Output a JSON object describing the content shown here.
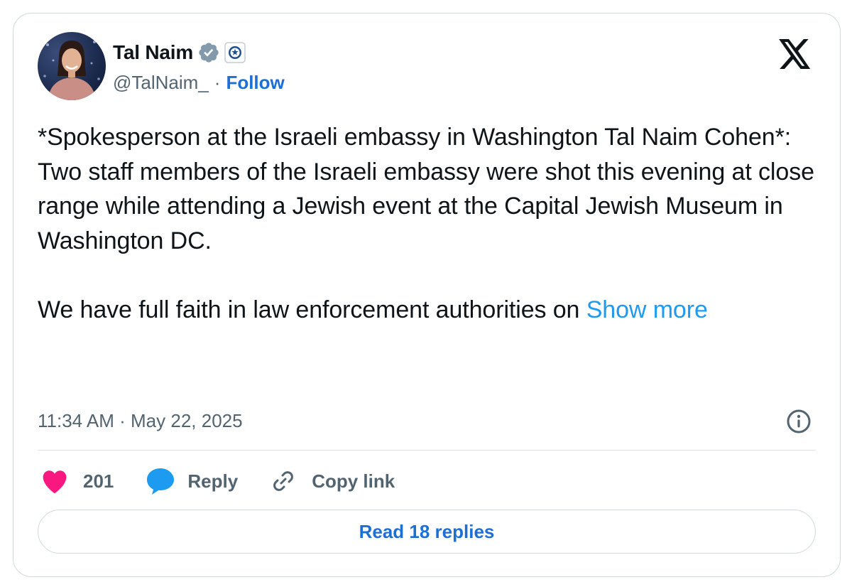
{
  "author": {
    "name": "Tal Naim",
    "handle": "@TalNaim_",
    "separator": "·",
    "follow_label": "Follow"
  },
  "tweet": {
    "text": "*Spokesperson at the Israeli embassy in Washington Tal Naim Cohen*:\nTwo staff members of the Israeli embassy were shot this evening at close range while attending a Jewish event at the Capital Jewish Museum in Washington DC.\n\nWe have full faith in law enforcement authorities on ",
    "show_more_label": "Show more",
    "timestamp": "11:34 AM · May 22, 2025"
  },
  "actions": {
    "likes_count": "201",
    "reply_label": "Reply",
    "copy_link_label": "Copy link"
  },
  "footer": {
    "read_replies_label": "Read 18 replies"
  },
  "icons": {
    "platform_logo": "x-logo-icon",
    "verified": "verified-badge-icon",
    "affiliate": "affiliate-badge-icon",
    "info": "info-icon",
    "like": "heart-icon",
    "reply": "speech-bubble-icon",
    "copy_link": "link-icon"
  },
  "colors": {
    "link_blue": "#1d9bf0",
    "follow_blue": "#1d6fd6",
    "heart_pink": "#f91880",
    "reply_blue": "#1d9bf0",
    "muted_text": "#536471",
    "border": "#cfd9de"
  }
}
